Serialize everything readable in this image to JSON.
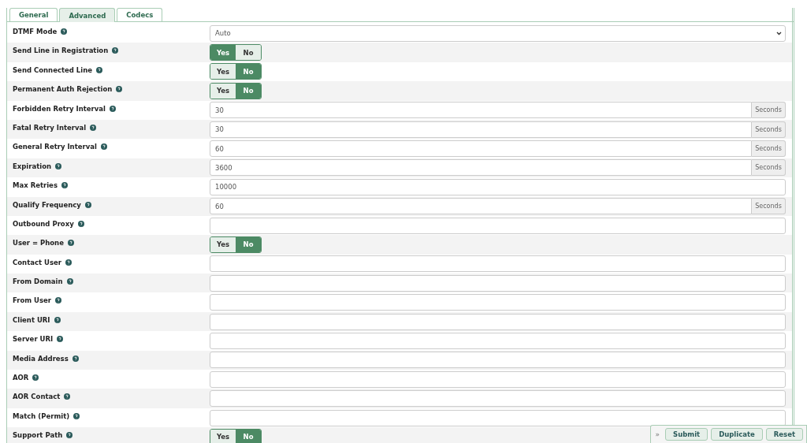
{
  "tabs": [
    {
      "label": "General",
      "selected": false
    },
    {
      "label": "Advanced",
      "selected": true
    },
    {
      "label": "Codecs",
      "selected": false
    }
  ],
  "fields": [
    {
      "label": "DTMF Mode",
      "kind": "select",
      "value": "Auto"
    },
    {
      "label": "Send Line in Registration",
      "kind": "toggle",
      "options": [
        {
          "label": "Yes",
          "selected": true
        },
        {
          "label": "No",
          "selected": false
        }
      ]
    },
    {
      "label": "Send Connected Line",
      "kind": "toggle",
      "options": [
        {
          "label": "Yes",
          "selected": false
        },
        {
          "label": "No",
          "selected": true
        }
      ]
    },
    {
      "label": "Permanent Auth Rejection",
      "kind": "toggle",
      "options": [
        {
          "label": "Yes",
          "selected": false
        },
        {
          "label": "No",
          "selected": true
        }
      ]
    },
    {
      "label": "Forbidden Retry Interval",
      "kind": "input",
      "value": "30",
      "suffix": "Seconds"
    },
    {
      "label": "Fatal Retry Interval",
      "kind": "input",
      "value": "30",
      "suffix": "Seconds"
    },
    {
      "label": "General Retry Interval",
      "kind": "input",
      "value": "60",
      "suffix": "Seconds"
    },
    {
      "label": "Expiration",
      "kind": "input",
      "value": "3600",
      "suffix": "Seconds"
    },
    {
      "label": "Max Retries",
      "kind": "input",
      "value": "10000"
    },
    {
      "label": "Qualify Frequency",
      "kind": "input",
      "value": "60",
      "suffix": "Seconds"
    },
    {
      "label": "Outbound Proxy",
      "kind": "input"
    },
    {
      "label": "User = Phone",
      "kind": "toggle",
      "options": [
        {
          "label": "Yes",
          "selected": false
        },
        {
          "label": "No",
          "selected": true
        }
      ]
    },
    {
      "label": "Contact User",
      "kind": "input"
    },
    {
      "label": "From Domain",
      "kind": "input"
    },
    {
      "label": "From User",
      "kind": "input"
    },
    {
      "label": "Client URI",
      "kind": "input"
    },
    {
      "label": "Server URI",
      "kind": "input"
    },
    {
      "label": "Media Address",
      "kind": "input"
    },
    {
      "label": "AOR",
      "kind": "input"
    },
    {
      "label": "AOR Contact",
      "kind": "input"
    },
    {
      "label": "Match (Permit)",
      "kind": "input"
    },
    {
      "label": "Support Path",
      "kind": "toggle",
      "options": [
        {
          "label": "Yes",
          "selected": false
        },
        {
          "label": "No",
          "selected": true
        }
      ]
    }
  ],
  "action_bar": {
    "toggle": "»",
    "buttons": [
      "Submit",
      "Duplicate",
      "Reset"
    ]
  }
}
